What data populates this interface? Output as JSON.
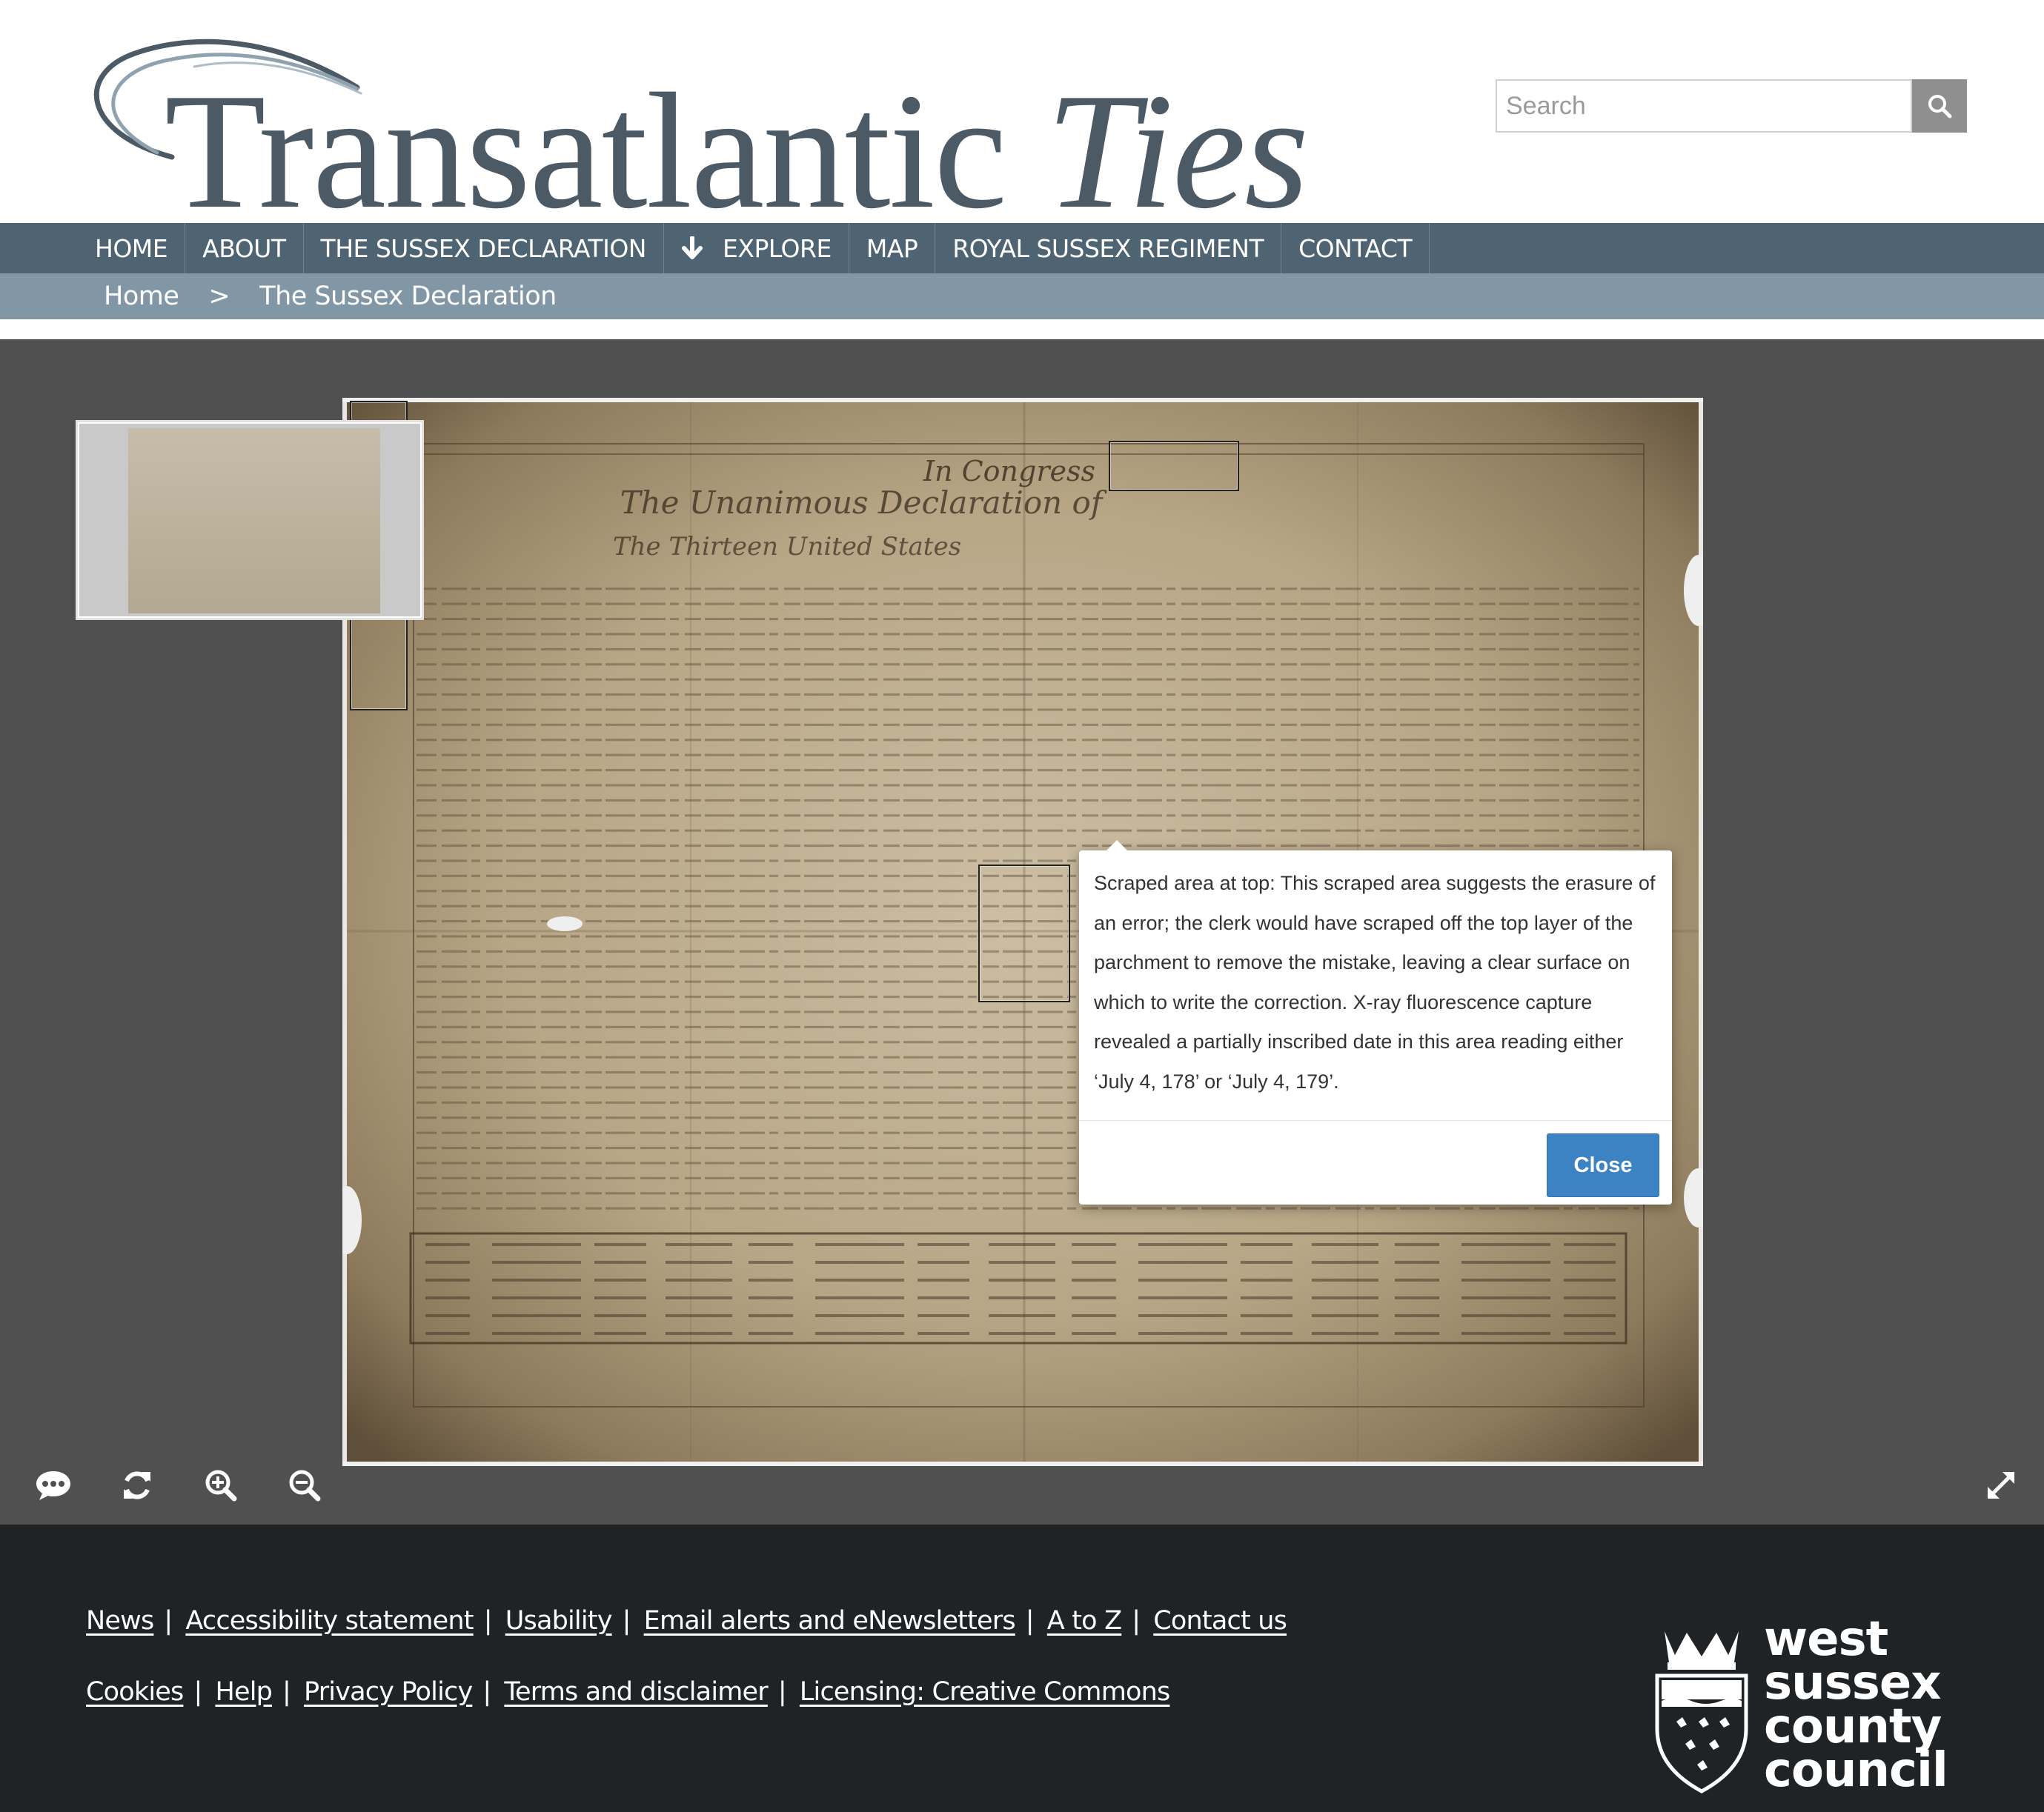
{
  "site": {
    "title_part1": "Transatlantic ",
    "title_part2": "Ties",
    "brand_color": "#4c5a66"
  },
  "search": {
    "placeholder": "Search",
    "icon": "search-icon"
  },
  "nav": {
    "items": [
      {
        "label": "HOME"
      },
      {
        "label": "ABOUT"
      },
      {
        "label": "THE SUSSEX DECLARATION"
      },
      {
        "label": "EXPLORE",
        "icon": "arrow-down-icon"
      },
      {
        "label": "MAP"
      },
      {
        "label": "ROYAL SUSSEX REGIMENT"
      },
      {
        "label": "CONTACT"
      }
    ],
    "background": "#4f6472"
  },
  "breadcrumb": {
    "home": "Home",
    "separator": ">",
    "current": "The Sussex Declaration",
    "background": "#8197a5"
  },
  "viewer": {
    "document": "The Sussex Declaration",
    "header_script": "In Congress",
    "title_script": "The Unanimous Declaration of",
    "subtitle_script": "The Thirteen United States",
    "toolbar": [
      {
        "icon": "comments-icon"
      },
      {
        "icon": "refresh-icon"
      },
      {
        "icon": "zoom-in-icon"
      },
      {
        "icon": "zoom-out-icon"
      },
      {
        "icon": "fullscreen-icon"
      }
    ]
  },
  "popup": {
    "text": "Scraped area at top: This scraped area suggests the erasure of an error; the clerk would have scraped off the top layer of the parchment to remove the mistake, leaving a clear surface on which to write the correction. X-ray fluorescence capture revealed a partially inscribed date in this area reading either ‘July 4, 178’ or ‘July 4, 179’.",
    "close_label": "Close",
    "button_color": "#3d82c3"
  },
  "footer": {
    "links_row1": [
      "News",
      "Accessibility statement",
      "Usability",
      "Email alerts and eNewsletters",
      "A to Z",
      "Contact us"
    ],
    "links_row2": [
      "Cookies",
      "Help",
      "Privacy Policy",
      "Terms and disclaimer",
      "Licensing: Creative Commons"
    ],
    "logo_lines": [
      "west",
      "sussex",
      "county",
      "council"
    ],
    "background": "#1f2326"
  }
}
